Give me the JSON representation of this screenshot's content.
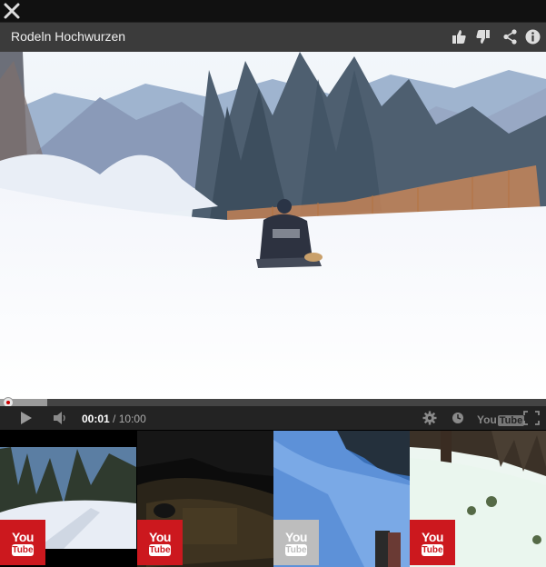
{
  "window": {
    "close_label": "close"
  },
  "video": {
    "title": "Rodeln Hochwurzen",
    "current_time": "00:01",
    "separator": "/",
    "duration": "10:00",
    "progress_fraction": 0.0017,
    "buffered_fraction": 0.086
  },
  "controls": {
    "brand_you": "You",
    "brand_tube": "Tube"
  },
  "related": [
    {
      "badge_you": "You",
      "badge_tube": "Tube",
      "badge_color": "#cc181e"
    },
    {
      "badge_you": "You",
      "badge_tube": "Tube",
      "badge_color": "#cc181e"
    },
    {
      "badge_you": "You",
      "badge_tube": "Tube",
      "badge_color": "#bdbdbd"
    },
    {
      "badge_you": "You",
      "badge_tube": "Tube",
      "badge_color": "#cc181e"
    }
  ],
  "colors": {
    "accent": "#cc181e",
    "titlebar": "#3b3b3b",
    "controlbar": "#232323"
  }
}
